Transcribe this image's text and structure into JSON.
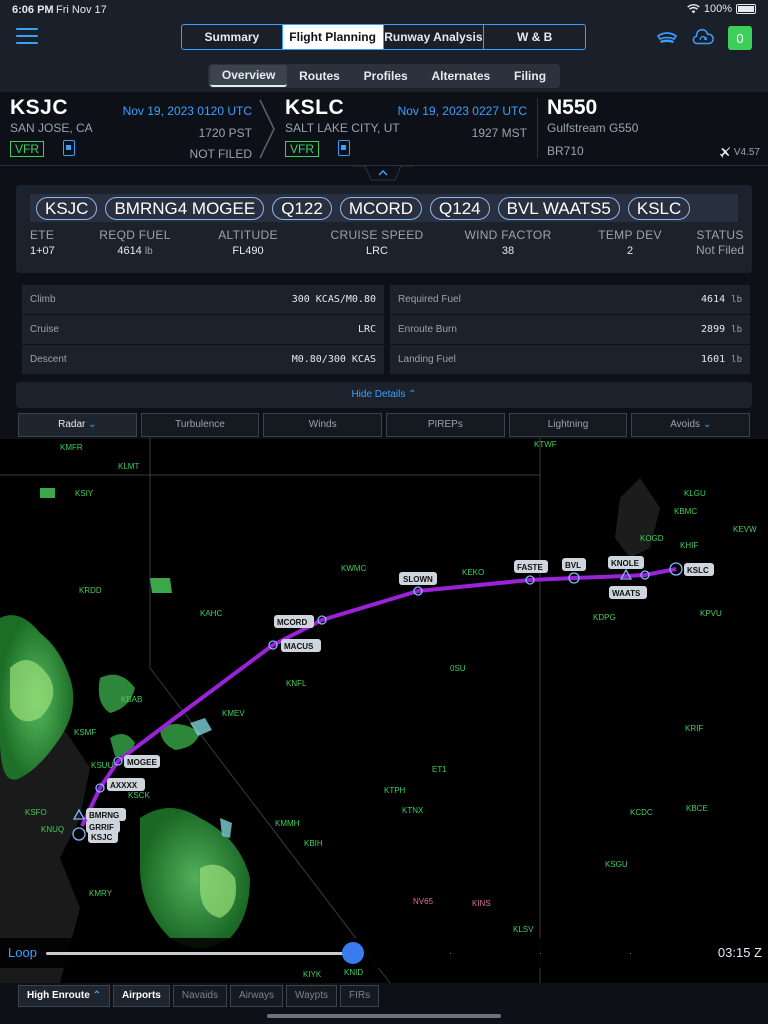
{
  "status_bar": {
    "time": "6:06 PM",
    "date": "Fri Nov 17",
    "battery": "100%"
  },
  "nav": {
    "tabs": [
      "Summary",
      "Flight Planning",
      "Runway Analysis",
      "W & B"
    ],
    "active_tab": "Flight Planning",
    "badge_count": "0",
    "subtabs": [
      "Overview",
      "Routes",
      "Profiles",
      "Alternates",
      "Filing"
    ],
    "active_subtab": "Overview"
  },
  "departure": {
    "code": "KSJC",
    "city": "SAN JOSE, CA",
    "utc": "Nov 19, 2023 0120 UTC",
    "local": "1720 PST",
    "filing": "NOT FILED",
    "rules": "VFR"
  },
  "arrival": {
    "code": "KSLC",
    "city": "SALT LAKE CITY, UT",
    "utc": "Nov 19, 2023 0227 UTC",
    "local": "1927 MST",
    "rules": "VFR"
  },
  "aircraft": {
    "tail": "N550",
    "type": "Gulfstream G550",
    "engine": "BR710",
    "version": "V4.57"
  },
  "route": [
    "KSJC",
    "BMRNG4 MOGEE",
    "Q122",
    "MCORD",
    "Q124",
    "BVL WAATS5",
    "KSLC"
  ],
  "stats": {
    "ete_label": "ETE",
    "ete": "1+07",
    "fuel_label": "REQD FUEL",
    "fuel": "4614",
    "fuel_unit": "lb",
    "alt_label": "ALTITUDE",
    "alt": "FL490",
    "speed_label": "CRUISE SPEED",
    "speed": "LRC",
    "wind_label": "WIND FACTOR",
    "wind": "38",
    "temp_label": "TEMP DEV",
    "temp": "2",
    "status_label": "STATUS",
    "status": "Not Filed"
  },
  "profile": [
    {
      "k": "Climb",
      "v": "300 KCAS/M0.80"
    },
    {
      "k": "Cruise",
      "v": "LRC"
    },
    {
      "k": "Descent",
      "v": "M0.80/300 KCAS"
    }
  ],
  "fuel_rows": [
    {
      "k": "Required Fuel",
      "v": "4614",
      "u": "lb"
    },
    {
      "k": "Enroute Burn",
      "v": "2899",
      "u": "lb"
    },
    {
      "k": "Landing Fuel",
      "v": "1601",
      "u": "lb"
    }
  ],
  "hide_details": "Hide Details",
  "layers": [
    "Radar",
    "Turbulence",
    "Winds",
    "PIREPs",
    "Lightning",
    "Avoids"
  ],
  "map": {
    "waypoints": [
      "SLOWN",
      "FASTE",
      "BVL",
      "KNOLE",
      "WAATS",
      "KSLC",
      "MCORD",
      "MACUS",
      "MOGEE",
      "AXXXX",
      "BMRNG",
      "GRRIF",
      "KSJC"
    ],
    "airports": [
      "KMFR",
      "KLMT",
      "KTWF",
      "KLGU",
      "KSIY",
      "KBMC",
      "KOGD",
      "KHIF",
      "KEVW",
      "KWMC",
      "KEKO",
      "KRDD",
      "KAHC",
      "KDPG",
      "KPVU",
      "0SU",
      "KNFL",
      "KMEV",
      "KBAB",
      "KSMF",
      "KSUU",
      "KSCK",
      "ET1",
      "KRIF",
      "KTPH",
      "KTNX",
      "KCDC",
      "KBCE",
      "KSFO",
      "KNUQ",
      "KMMH",
      "KBIH",
      "KSGU",
      "KMRY",
      "KIYK",
      "KNID",
      "KLSV"
    ],
    "restricted": [
      "NV65",
      "KINS"
    ]
  },
  "loop": {
    "label": "Loop",
    "time": "03:15 Z",
    "progress": 0.47
  },
  "bottom": [
    "High Enroute",
    "Airports",
    "Navaids",
    "Airways",
    "Waypts",
    "FIRs"
  ],
  "colors": {
    "accent": "#3aa0ff",
    "route": "#9a22d8",
    "vfr": "#3ecf5a"
  }
}
